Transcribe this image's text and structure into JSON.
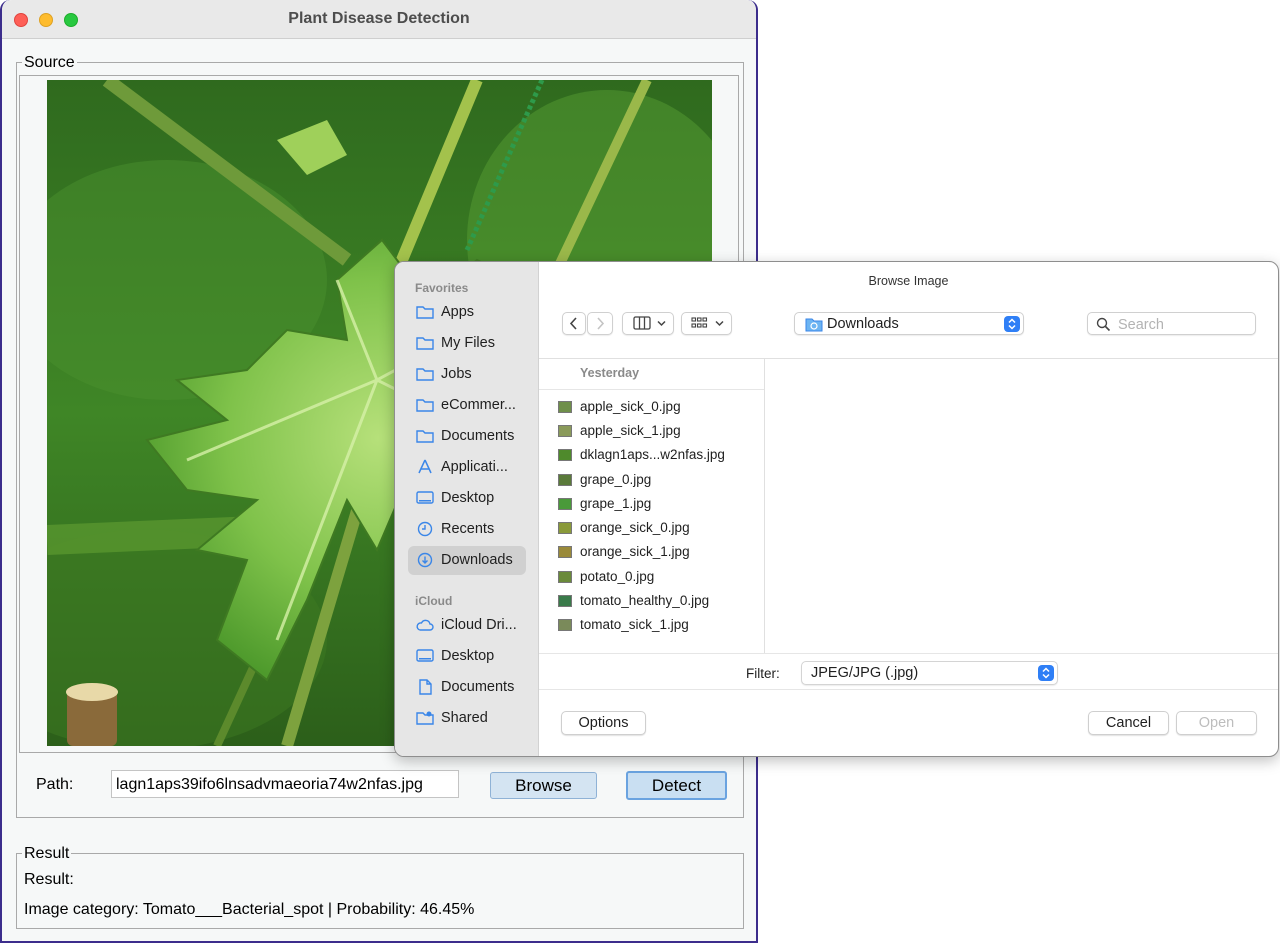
{
  "app": {
    "window_title": "Plant Disease Detection",
    "source_legend": "Source",
    "image_alt": "green grape leaf",
    "path_label": "Path:",
    "path_value": "lagn1aps39ifo6lnsadvmaeoria74w2nfas.jpg",
    "browse_label": "Browse",
    "detect_label": "Detect",
    "result_legend": "Result",
    "result_label": "Result:",
    "result_text": "Image category: Tomato___Bacterial_spot | Probability: 46.45%"
  },
  "dialog": {
    "title": "Browse Image",
    "sidebar": {
      "favorites_header": "Favorites",
      "favorites": [
        {
          "label": "Apps",
          "icon": "folder-icon"
        },
        {
          "label": "My Files",
          "icon": "folder-icon"
        },
        {
          "label": "Jobs",
          "icon": "folder-icon"
        },
        {
          "label": "eCommer...",
          "icon": "folder-icon"
        },
        {
          "label": "Documents",
          "icon": "folder-icon"
        },
        {
          "label": "Applicati...",
          "icon": "applications-icon"
        },
        {
          "label": "Desktop",
          "icon": "desktop-icon"
        },
        {
          "label": "Recents",
          "icon": "clock-icon"
        },
        {
          "label": "Downloads",
          "icon": "download-icon",
          "selected": true
        }
      ],
      "icloud_header": "iCloud",
      "icloud": [
        {
          "label": "iCloud Dri...",
          "icon": "cloud-icon"
        },
        {
          "label": "Desktop",
          "icon": "desktop-icon"
        },
        {
          "label": "Documents",
          "icon": "document-icon"
        },
        {
          "label": "Shared",
          "icon": "shared-folder-icon"
        }
      ]
    },
    "location": "Downloads",
    "search_placeholder": "Search",
    "group_header": "Yesterday",
    "files": [
      "apple_sick_0.jpg",
      "apple_sick_1.jpg",
      "dklagn1aps...w2nfas.jpg",
      "grape_0.jpg",
      "grape_1.jpg",
      "orange_sick_0.jpg",
      "orange_sick_1.jpg",
      "potato_0.jpg",
      "tomato_healthy_0.jpg",
      "tomato_sick_1.jpg"
    ],
    "filter_label": "Filter:",
    "filter_value": "JPEG/JPG (.jpg)",
    "options_label": "Options",
    "cancel_label": "Cancel",
    "open_label": "Open"
  },
  "colors": {
    "accent": "#2f7ff6",
    "qt_button": "#d4e4f2",
    "window_border": "#3c2d8c"
  }
}
